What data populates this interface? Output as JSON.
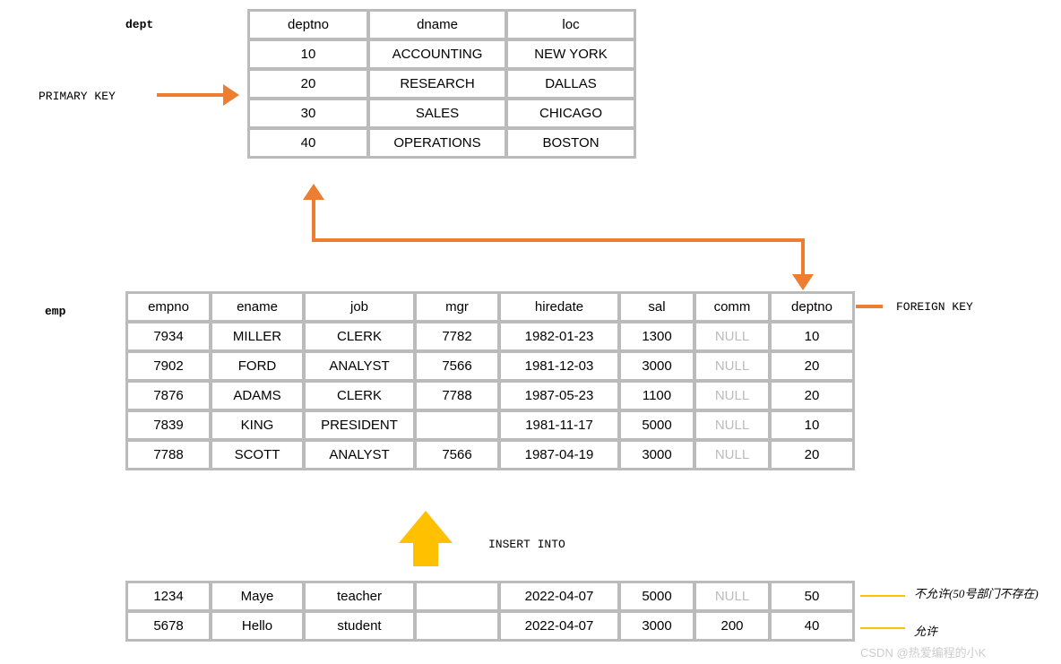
{
  "labels": {
    "dept": "dept",
    "emp": "emp",
    "primary_key": "PRIMARY KEY",
    "foreign_key": "FOREIGN KEY",
    "insert_into": "INSERT INTO",
    "not_allowed": "不允许(50号部门不存在)",
    "allowed": "允许",
    "watermark": "CSDN @热爱编程的小K"
  },
  "dept": {
    "headers": [
      "deptno",
      "dname",
      "loc"
    ],
    "rows": [
      [
        "10",
        "ACCOUNTING",
        "NEW YORK"
      ],
      [
        "20",
        "RESEARCH",
        "DALLAS"
      ],
      [
        "30",
        "SALES",
        "CHICAGO"
      ],
      [
        "40",
        "OPERATIONS",
        "BOSTON"
      ]
    ]
  },
  "emp": {
    "headers": [
      "empno",
      "ename",
      "job",
      "mgr",
      "hiredate",
      "sal",
      "comm",
      "deptno"
    ],
    "rows": [
      [
        "7934",
        "MILLER",
        "CLERK",
        "7782",
        "1982-01-23",
        "1300",
        "NULL",
        "10"
      ],
      [
        "7902",
        "FORD",
        "ANALYST",
        "7566",
        "1981-12-03",
        "3000",
        "NULL",
        "20"
      ],
      [
        "7876",
        "ADAMS",
        "CLERK",
        "7788",
        "1987-05-23",
        "1100",
        "NULL",
        "20"
      ],
      [
        "7839",
        "KING",
        "PRESIDENT",
        "",
        "1981-11-17",
        "5000",
        "NULL",
        "10"
      ],
      [
        "7788",
        "SCOTT",
        "ANALYST",
        "7566",
        "1987-04-19",
        "3000",
        "NULL",
        "20"
      ]
    ]
  },
  "insert": {
    "rows": [
      [
        "1234",
        "Maye",
        "teacher",
        "",
        "2022-04-07",
        "5000",
        "NULL",
        "50"
      ],
      [
        "5678",
        "Hello",
        "student",
        "",
        "2022-04-07",
        "3000",
        "200",
        "40"
      ]
    ]
  }
}
